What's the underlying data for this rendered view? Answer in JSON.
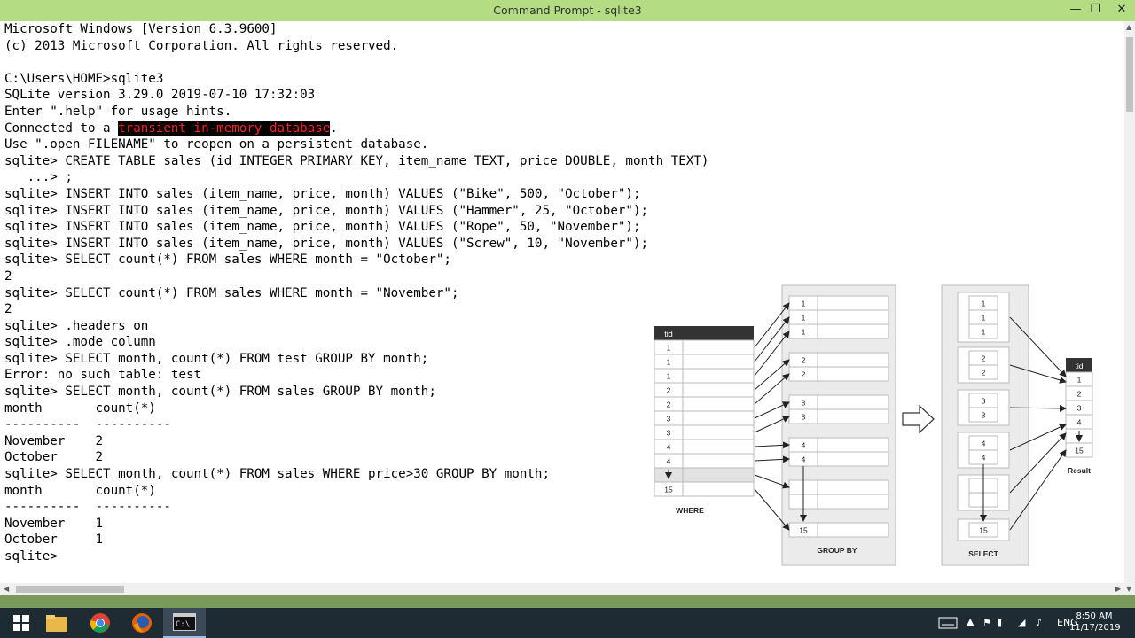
{
  "window": {
    "title": "Command Prompt - sqlite3",
    "minimize_label": "—",
    "maximize_label": "❐",
    "close_label": "✕"
  },
  "console": {
    "lines": [
      "Microsoft Windows [Version 6.3.9600]",
      "(c) 2013 Microsoft Corporation. All rights reserved.",
      "",
      "C:\\Users\\HOME>sqlite3",
      "SQLite version 3.29.0 2019-07-10 17:32:03",
      "Enter \".help\" for usage hints.",
      "",
      "Use \".open FILENAME\" to reopen on a persistent database.",
      "sqlite> CREATE TABLE sales (id INTEGER PRIMARY KEY, item_name TEXT, price DOUBLE, month TEXT)",
      "   ...> ;",
      "sqlite> INSERT INTO sales (item_name, price, month) VALUES (\"Bike\", 500, \"October\");",
      "sqlite> INSERT INTO sales (item_name, price, month) VALUES (\"Hammer\", 25, \"October\");",
      "sqlite> INSERT INTO sales (item_name, price, month) VALUES (\"Rope\", 50, \"November\");",
      "sqlite> INSERT INTO sales (item_name, price, month) VALUES (\"Screw\", 10, \"November\");",
      "sqlite> SELECT count(*) FROM sales WHERE month = \"October\";",
      "2",
      "sqlite> SELECT count(*) FROM sales WHERE month = \"November\";",
      "2",
      "sqlite> .headers on",
      "sqlite> .mode column",
      "sqlite> SELECT month, count(*) FROM test GROUP BY month;",
      "Error: no such table: test",
      "sqlite> SELECT month, count(*) FROM sales GROUP BY month;",
      "month       count(*)",
      "----------  ----------",
      "November    2",
      "October     2",
      "sqlite> SELECT month, count(*) FROM sales WHERE price>30 GROUP BY month;",
      "month       count(*)",
      "----------  ----------",
      "November    1",
      "October     1",
      "sqlite> "
    ],
    "connected_prefix": "Connected to a ",
    "connected_highlight": "transient in-memory database",
    "connected_suffix": "."
  },
  "figure": {
    "where": {
      "header_tid": "tid",
      "rows": [
        "1",
        "1",
        "1",
        "2",
        "2",
        "3",
        "3",
        "4",
        "4",
        "",
        "15"
      ],
      "label": "WHERE"
    },
    "group_by": {
      "groups": [
        [
          "1",
          "1",
          "1"
        ],
        [
          "2",
          "2"
        ],
        [
          "3",
          "3"
        ],
        [
          "4",
          "4"
        ],
        [
          "",
          ""
        ]
      ],
      "last": "15",
      "label": "GROUP BY"
    },
    "select": {
      "groups": [
        [
          "1",
          "1",
          "1"
        ],
        [
          "2",
          "2"
        ],
        [
          "3",
          "3"
        ],
        [
          "4",
          "4"
        ],
        [
          "",
          ""
        ]
      ],
      "last": "15",
      "label": "SELECT"
    },
    "result": {
      "header_tid": "tid",
      "rows": [
        "1",
        "2",
        "3",
        "4",
        "",
        "15"
      ],
      "label": "Result"
    }
  },
  "taskbar": {
    "items": [
      "start-icon",
      "file-explorer-icon",
      "chrome-icon",
      "firefox-icon",
      "command-prompt-icon"
    ],
    "language": "ENG",
    "time": "8:50 AM",
    "date": "11/17/2019"
  }
}
